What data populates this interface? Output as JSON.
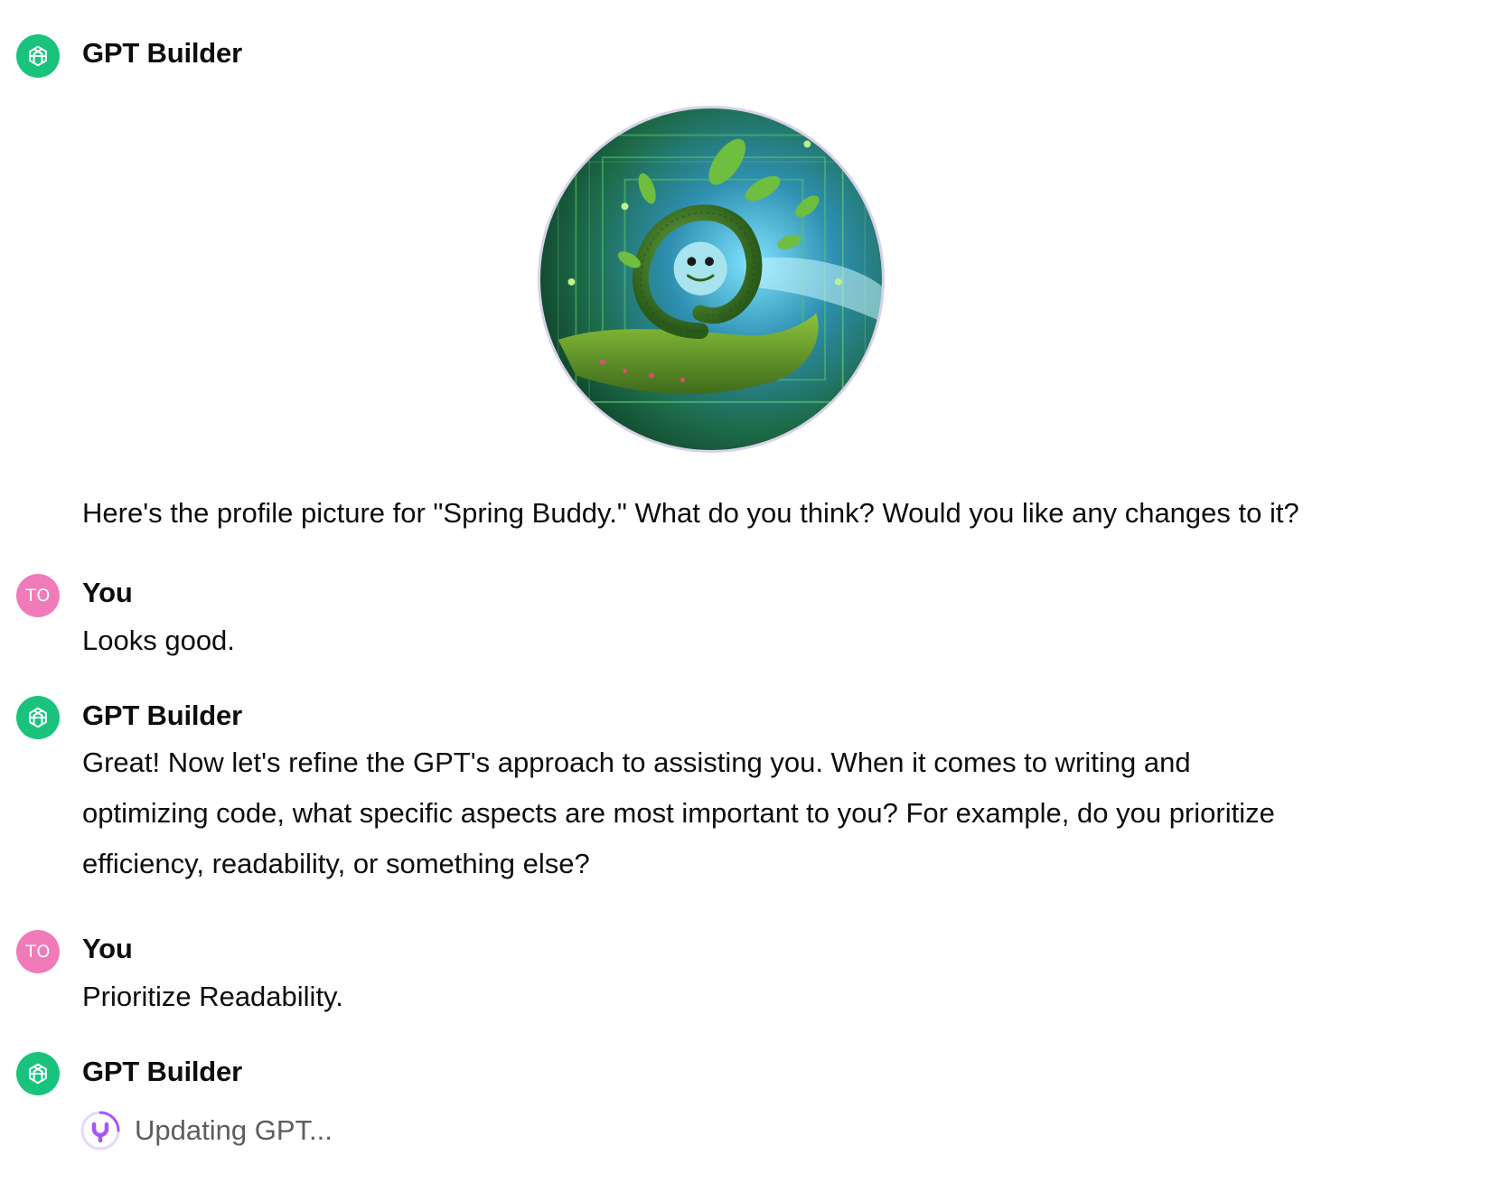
{
  "conversation": {
    "messages": [
      {
        "author": "GPT Builder",
        "avatar_icon": "openai-logo-icon",
        "image": "profile-picture-spring-buddy",
        "text": "Here's the profile picture for \"Spring Buddy.\" What do you think? Would you like any changes to it?"
      },
      {
        "author": "You",
        "avatar_initials": "TO",
        "text": "Looks good."
      },
      {
        "author": "GPT Builder",
        "avatar_icon": "openai-logo-icon",
        "text_lines": [
          "Great! Now let's refine the GPT's approach to assisting you. When it comes to writing and",
          "optimizing code, what specific aspects are most important to you? For example, do you prioritize",
          "efficiency, readability, or something else?"
        ]
      },
      {
        "author": "You",
        "avatar_initials": "TO",
        "text": "Prioritize Readability."
      },
      {
        "author": "GPT Builder",
        "avatar_icon": "openai-logo-icon",
        "status_icon": "updating-spinner-icon",
        "status": "Updating GPT..."
      }
    ]
  },
  "colors": {
    "gpt_avatar": "#19c37d",
    "user_avatar": "#f07bb8",
    "spinner_accent": "#a855f7",
    "status_text": "#5d5d5d"
  }
}
